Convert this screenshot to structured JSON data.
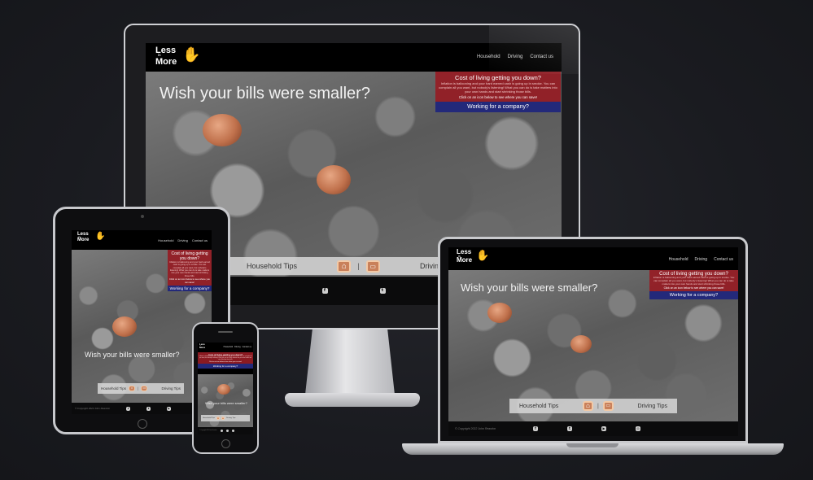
{
  "site": {
    "logo": {
      "line1": "Less",
      "line2": "is",
      "line3": "More"
    },
    "nav": [
      "Household",
      "Driving",
      "Contact us"
    ],
    "hero_title": "Wish your bills were smaller?",
    "info": {
      "heading": "Cost of living getting you down?",
      "body": "Inflation is ballooning and your hard earned cash is going up in smoke. You can complain all you want, but nobody's listening! What you can do is take matters into your own hands and start shrinking those bills.",
      "cta": "Click on an icon below to see where you can save!",
      "company": "Working for a company?"
    },
    "tips": {
      "household": "Household Tips",
      "separator": "|",
      "driving": "Driving Tips"
    },
    "footer": {
      "copyright": "© Copyright 2022 John Reardon",
      "social": [
        "facebook-icon",
        "twitter-icon",
        "youtube-icon",
        "instagram-icon"
      ]
    }
  },
  "colors": {
    "info_red": "#961c24",
    "info_blue": "#23297a",
    "tip_icon": "#c9805a",
    "page_bg": "#1a1b20"
  }
}
